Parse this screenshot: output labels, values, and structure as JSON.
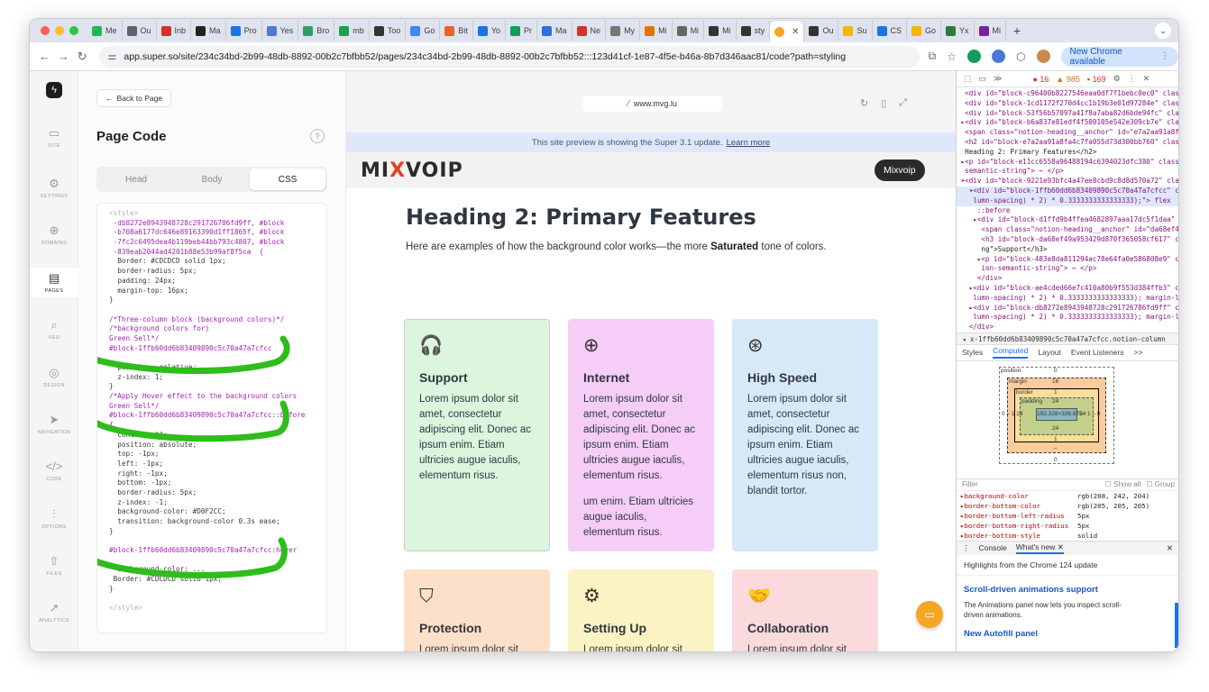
{
  "browser": {
    "tabs": [
      {
        "label": "Me",
        "color": "#1db954"
      },
      {
        "label": "Ou",
        "color": "#5f6368"
      },
      {
        "label": "Inb",
        "color": "#d93025"
      },
      {
        "label": "Ma",
        "color": "#222222"
      },
      {
        "label": "Pro",
        "color": "#1a73e8"
      },
      {
        "label": "Yes",
        "color": "#4b7bd0"
      },
      {
        "label": "Bro",
        "color": "#2d9c6b"
      },
      {
        "label": "mb",
        "color": "#16a34a"
      },
      {
        "label": "Too",
        "color": "#333333"
      },
      {
        "label": "Go",
        "color": "#4285f4"
      },
      {
        "label": "Bit",
        "color": "#ee6123"
      },
      {
        "label": "Yo",
        "color": "#1a73e8"
      },
      {
        "label": "Pr",
        "color": "#0f9d58"
      },
      {
        "label": "Ma",
        "color": "#2f6fdd"
      },
      {
        "label": "Ne",
        "color": "#d93025"
      },
      {
        "label": "My",
        "color": "#777777"
      },
      {
        "label": "Mi",
        "color": "#e37400"
      },
      {
        "label": "Mi",
        "color": "#666666"
      },
      {
        "label": "Mi",
        "color": "#333333"
      },
      {
        "label": "sty",
        "color": "#333333"
      },
      {
        "label": "Ou",
        "color": "#333333"
      },
      {
        "label": "Su",
        "color": "#f4b400"
      },
      {
        "label": "CS",
        "color": "#1a73e8"
      },
      {
        "label": "Go",
        "color": "#f4b400"
      },
      {
        "label": "Yx",
        "color": "#2d7a3d"
      },
      {
        "label": "Mi",
        "color": "#7b1fa2"
      }
    ],
    "active_tab_icon_color": "#f5a623",
    "new_tab": "+",
    "tab_menu": "⌄",
    "url": "app.super.so/site/234c34bd-2b99-48db-8892-00b2c7bfbb52/pages/234c34bd-2b99-48db-8892-00b2c7bfbb52:::123d41cf-1e87-4f5e-b46a-8b7d346aac81/code?path=styling",
    "update_button": "New Chrome available",
    "more_icon": "⋮"
  },
  "leftnav": {
    "items": [
      {
        "icon": "▭",
        "label": "SITE",
        "name": "monitor-icon"
      },
      {
        "icon": "⚙",
        "label": "SETTINGS",
        "name": "gear-icon"
      },
      {
        "icon": "⊕",
        "label": "DOMAINS",
        "name": "globe-icon"
      },
      {
        "icon": "▤",
        "label": "PAGES",
        "name": "page-icon"
      },
      {
        "icon": "⌕",
        "label": "SEO",
        "name": "search-icon"
      },
      {
        "icon": "◎",
        "label": "DESIGN",
        "name": "palette-icon"
      },
      {
        "icon": "➤",
        "label": "NAVIGATION",
        "name": "navigation-icon"
      },
      {
        "icon": "</>",
        "label": "CODE",
        "name": "code-icon"
      },
      {
        "icon": "⫶",
        "label": "OPTIONS",
        "name": "sliders-icon"
      },
      {
        "icon": "⇧",
        "label": "FILES",
        "name": "upload-icon"
      },
      {
        "icon": "↗",
        "label": "ANALYTICS",
        "name": "analytics-icon"
      }
    ]
  },
  "codepanel": {
    "back_label": "Back to Page",
    "title": "Page Code",
    "help_icon": "?",
    "tabs": [
      "Head",
      "Body",
      "CSS"
    ],
    "code": [
      {
        "t": "<style>",
        "c": "tag"
      },
      {
        "t": " -db8272e8943948728c291726786fd9ff, #block",
        "c": "sel"
      },
      {
        "t": " -b708a6177dc646e89163390d1ff1865f, #block",
        "c": "sel"
      },
      {
        "t": " -7fc2c6495dea4b119beb44bb793c4807, #block",
        "c": "sel"
      },
      {
        "t": " -839eab2044ad4201b88e53b99af8f5ca  {",
        "c": "sel"
      },
      {
        "t": "  Border: #CDCDCD solid 1px;",
        "c": "prop"
      },
      {
        "t": "  border-radius: 5px;",
        "c": "prop"
      },
      {
        "t": "  padding: 24px;",
        "c": "prop"
      },
      {
        "t": "  margin-top: 16px;",
        "c": "prop"
      },
      {
        "t": "}",
        "c": "plain"
      },
      {
        "t": "",
        "c": "plain"
      },
      {
        "t": "/*Three-column block (background colors)*/",
        "c": "com"
      },
      {
        "t": "/*background colors for)",
        "c": "com"
      },
      {
        "t": "Green Sell*/",
        "c": "com"
      },
      {
        "t": "#block-1ffb60dd6b83409890c5c70a47a7cfcc",
        "c": "sel"
      },
      {
        "t": "",
        "c": "plain"
      },
      {
        "t": "  position: relative;",
        "c": "prop"
      },
      {
        "t": "  z-index: 1;",
        "c": "prop"
      },
      {
        "t": "}",
        "c": "plain"
      },
      {
        "t": "/*Apply Hover effect to the background colors",
        "c": "com"
      },
      {
        "t": "Green Sell*/",
        "c": "com"
      },
      {
        "t": "#block-1ffb60dd6b83409890c5c70a47a7cfcc::before",
        "c": "sel"
      },
      {
        "t": "{",
        "c": "plain"
      },
      {
        "t": "  content: \"\";",
        "c": "prop"
      },
      {
        "t": "  position: absolute;",
        "c": "prop"
      },
      {
        "t": "  top: -1px;",
        "c": "prop"
      },
      {
        "t": "  left: -1px;",
        "c": "prop"
      },
      {
        "t": "  right: -1px;",
        "c": "prop"
      },
      {
        "t": "  bottom: -1px;",
        "c": "prop"
      },
      {
        "t": "  border-radius: 5px;",
        "c": "prop"
      },
      {
        "t": "  z-index: -1;",
        "c": "prop"
      },
      {
        "t": "  background-color: #D0F2CC;",
        "c": "prop"
      },
      {
        "t": "  transition: background-color 0.3s ease;",
        "c": "prop"
      },
      {
        "t": "}",
        "c": "plain"
      },
      {
        "t": "",
        "c": "plain"
      },
      {
        "t": "#block-1ffb60dd6b83409890c5c70a47a7cfcc:hover",
        "c": "sel"
      },
      {
        "t": "",
        "c": "plain"
      },
      {
        "t": "  background-color: ...",
        "c": "prop"
      },
      {
        "t": " Border: #CDCDCD solid 1px;",
        "c": "prop"
      },
      {
        "t": "}",
        "c": "plain"
      },
      {
        "t": "",
        "c": "plain"
      },
      {
        "t": "</style>",
        "c": "tag"
      }
    ]
  },
  "preview": {
    "url": "www.mvg.lu",
    "notice": "This site preview is showing the Super 3.1 update.",
    "notice_link": "Learn more",
    "logo_a": "MI",
    "logo_x": "X",
    "logo_b": "VOIP",
    "header_button": "Mixvoip",
    "heading": "Heading 2: Primary Features",
    "lead_a": "Here are examples of how the background color works—the more ",
    "lead_b": "Saturated",
    "lead_c": " tone of colors.",
    "cards": [
      {
        "title": "Support",
        "icon": "🎧",
        "name": "headset-icon",
        "bg": "#dcf5dc",
        "border": "#cdcdcd",
        "body": "Lorem ipsum dolor sit amet, consectetur adipiscing elit. Donec ac ipsum enim. Etiam ultricies augue iaculis, elementum risus.",
        "body2": ""
      },
      {
        "title": "Internet",
        "icon": "⊕",
        "name": "globe-icon",
        "bg": "#f5cdf6",
        "border": "#f5cdf6",
        "body": "Lorem ipsum dolor sit amet, consectetur adipiscing elit. Donec ac ipsum enim. Etiam ultricies augue iaculis, elementum risus.",
        "body2": "um enim. Etiam ultricies augue iaculis, elementum risus."
      },
      {
        "title": "High Speed",
        "icon": "⊛",
        "name": "speed-icon",
        "bg": "#d7e9f7",
        "border": "#d7e9f7",
        "body": "Lorem ipsum dolor sit amet, consectetur adipiscing elit. Donec ac ipsum enim. Etiam ultricies augue iaculis, elementum risus non, blandit tortor.",
        "body2": ""
      },
      {
        "title": "Protection",
        "icon": "⛉",
        "name": "shield-icon",
        "bg": "#fde0c9",
        "border": "#fde0c9",
        "body": "Lorem ipsum dolor sit amet, consectetur adipiscing elit. Donec ac ipsum enim. Etiam",
        "body2": ""
      },
      {
        "title": "Setting Up",
        "icon": "⚙",
        "name": "setup-icon",
        "bg": "#fbf3c4",
        "border": "#fbf3c4",
        "body": "Lorem ipsum dolor sit amet, consectetur adipiscing elit. Donec ac ipsum enim. Etiam",
        "body2": ""
      },
      {
        "title": "Collaboration",
        "icon": "🤝",
        "name": "handshake-icon",
        "bg": "#fadadd",
        "border": "#fadadd",
        "body": "Lorem ipsum dolor sit amet, consectetur adipiscing elit. Donec ac ipsum enim. Etiam",
        "body2": ""
      }
    ]
  },
  "devtools": {
    "errors": "16",
    "warnings": "985",
    "issues": "169",
    "dom": [
      {
        "t": "  <div id=\"block-c96400b8227546eaa0df7f1bebc0ec0\" clas",
        "c": ""
      },
      {
        "t": "  <div id=\"block-1cd1172f270d4cc1b19b3e01d97284e\" clas",
        "c": ""
      },
      {
        "t": "  <div id=\"block-53f56b57097a41f8a7aba82d6bde94fc\" clas",
        "c": ""
      },
      {
        "t": " ▸<div id=\"block-b6a837e81edf4f500105e542e309cb7e\" clas",
        "c": ""
      },
      {
        "t": "  <span class=\"notion-heading__anchor\" id=\"e7a2aa91a8fa",
        "c": ""
      },
      {
        "t": "  <h2 id=\"block-e7a2aa91a8fa4c7fa055d73d300bb760\" class",
        "c": ""
      },
      {
        "t": "  Heading 2: Primary Features</h2>",
        "c": "txt"
      },
      {
        "t": " ▸<p id=\"block-e11cc6558a96488194c6394023dfc380\" class=",
        "c": ""
      },
      {
        "t": "  semantic-string\"> ⋯ </p>",
        "c": ""
      },
      {
        "t": " ▾<div id=\"block-9221e93bfc4a47ee8cbd9c8d8d570a72\" clas",
        "c": ""
      },
      {
        "t": "   ▾<div id=\"block-1ffb60dd6b83409890c5c70a47a7cfcc\" cl",
        "c": "sel"
      },
      {
        "t": "    lumn-spacing) * 2) * 0.3333333333333333);\"> flex  ==",
        "c": "sel"
      },
      {
        "t": "     ::before",
        "c": ""
      },
      {
        "t": "    ▸<div id=\"block-d1ffd9b4ffea4682897aaa17dc5f1daa\"",
        "c": ""
      },
      {
        "t": "      <span class=\"notion-heading__anchor\" id=\"da68ef49a",
        "c": ""
      },
      {
        "t": "      <h3 id=\"block-da68ef49a953429d870f365058cf617\" c",
        "c": ""
      },
      {
        "t": "      ng\">Support</h3>",
        "c": "txt"
      },
      {
        "t": "     ▸<p id=\"block-483e8da811294ac78e64fa0e586808e9\" cl",
        "c": ""
      },
      {
        "t": "      ion-semantic-string\"> ⋯ </p>",
        "c": ""
      },
      {
        "t": "     </div>",
        "c": ""
      },
      {
        "t": "   ▸<div id=\"block-ae4cded66e7c410a80b9f553d384ffb3\" cl",
        "c": ""
      },
      {
        "t": "    lumn-spacing) * 2) * 0.3333333333333333); margin-li",
        "c": ""
      },
      {
        "t": "   ▸<div id=\"block-db8272e8943948728c291726786fd9ff\" cl",
        "c": ""
      },
      {
        "t": "    lumn-spacing) * 2) * 0.3333333333333333); margin-lin",
        "c": ""
      },
      {
        "t": "   </div>",
        "c": ""
      }
    ],
    "crumb": "x-1ffb60dd6b83409890c5c70a47a7cfcc.notion-column",
    "panel_tabs": [
      "Styles",
      "Computed",
      "Layout",
      "Event Listeners",
      ">>"
    ],
    "box": {
      "position_label": "position",
      "position_top": "0",
      "margin_label": "margin",
      "margin_top": "16",
      "border_label": "border",
      "border_top": "1",
      "padding_label": "padding",
      "padding_top": "24",
      "content": "192.328×336.875",
      "left_vals": "0 – 1 24",
      "right_vals": "24 1 – 0",
      "padding_bottom": "24",
      "border_bottom": "1",
      "margin_bottom": "–",
      "position_bottom": "0"
    },
    "filter_placeholder": "Filter",
    "show_all": "Show all",
    "group": "Group",
    "props": [
      {
        "n": "background-color",
        "v": "rgb(208, 242, 204)"
      },
      {
        "n": "border-bottom-color",
        "v": "rgb(205, 205, 205)"
      },
      {
        "n": "border-bottom-left-radius",
        "v": "5px"
      },
      {
        "n": "border-bottom-right-radius",
        "v": "5px"
      },
      {
        "n": "border-bottom-style",
        "v": "solid"
      }
    ],
    "drawer_tabs": [
      "Console",
      "What's new"
    ],
    "whatsnew_highlight": "Highlights from the Chrome 124 update",
    "wn1_title": "Scroll-driven animations support",
    "wn1_text": "The Animations panel now lets you inspect scroll-driven animations.",
    "wn2_title": "New Autofill panel"
  }
}
